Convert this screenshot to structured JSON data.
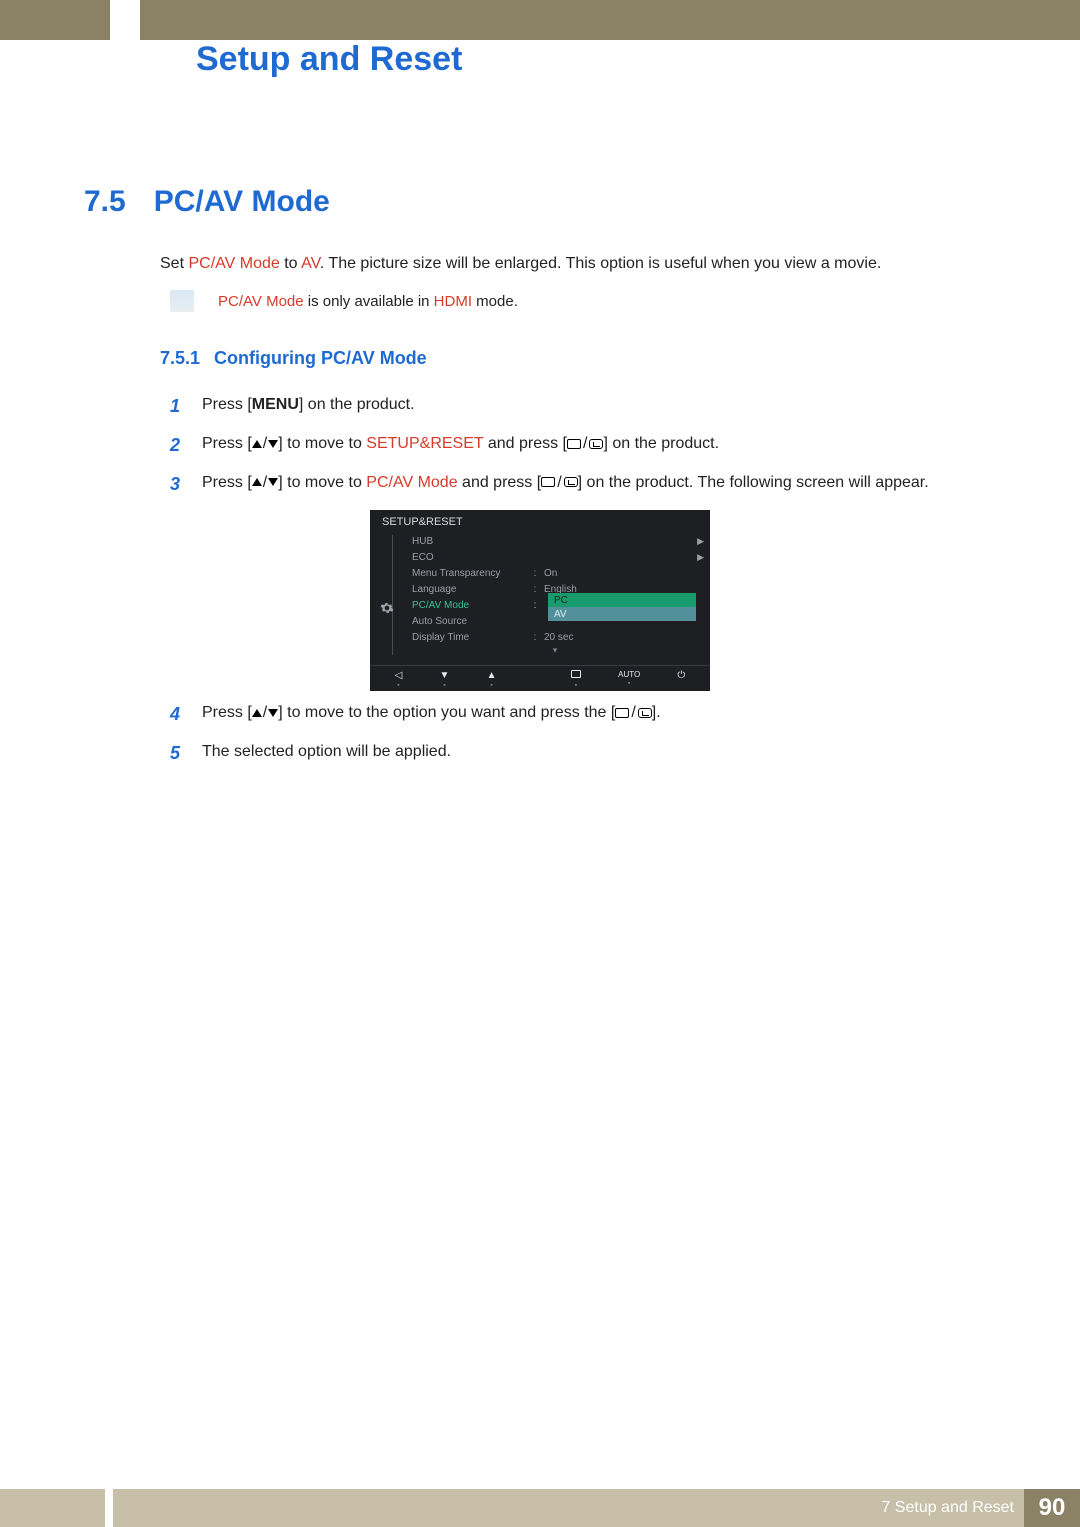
{
  "chapter_title": "Setup and Reset",
  "section": {
    "number": "7.5",
    "title": "PC/AV Mode"
  },
  "intro": {
    "pre": "Set ",
    "hl1": "PC/AV Mode",
    "mid": " to ",
    "hl2": "AV",
    "post": ". The picture size will be enlarged. This option is useful when you view a movie."
  },
  "note": {
    "hl1": "PC/AV Mode",
    "mid": " is only available in ",
    "hl2": "HDMI",
    "post": " mode."
  },
  "subsection": {
    "number": "7.5.1",
    "title": "Configuring PC/AV Mode"
  },
  "steps": {
    "s1": {
      "num": "1",
      "pre": "Press [",
      "menu": "MENU",
      "post": "] on the product."
    },
    "s2": {
      "num": "2",
      "pre": "Press [",
      "mid": "] to move to ",
      "hl": "SETUP&RESET",
      "mid2": " and press [",
      "post": "] on the product."
    },
    "s3": {
      "num": "3",
      "pre": "Press [",
      "mid": "] to move to ",
      "hl": "PC/AV Mode",
      "mid2": " and press [",
      "post": "] on the product. The following screen will appear."
    },
    "s4": {
      "num": "4",
      "pre": "Press [",
      "mid": "] to move to the option you want and press the [",
      "post": "]."
    },
    "s5": {
      "num": "5",
      "text": "The selected option will be applied."
    }
  },
  "osd": {
    "title": "SETUP&RESET",
    "items": {
      "hub": "HUB",
      "eco": "ECO",
      "menu_trans_l": "Menu Transparency",
      "menu_trans_v": "On",
      "lang_l": "Language",
      "lang_v": "English",
      "pcav_l": "PC/AV Mode",
      "pc": "PC",
      "av": "AV",
      "auto_src_l": "Auto Source",
      "disp_time_l": "Display Time",
      "disp_time_v": "20 sec"
    },
    "nav": {
      "auto": "AUTO"
    }
  },
  "footer": {
    "label": "7 Setup and Reset",
    "page": "90"
  }
}
